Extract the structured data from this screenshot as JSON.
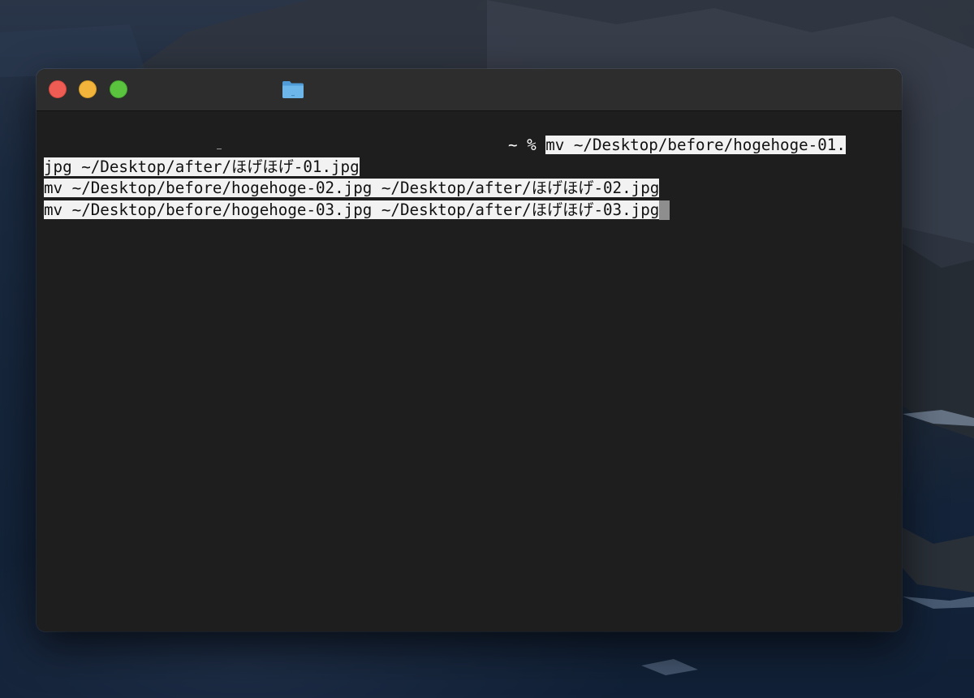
{
  "window": {
    "title_icon": "folder-icon",
    "title_icon_color": "#5aa6e0",
    "traffic_lights": {
      "close_color": "#ee5c54",
      "minimize_color": "#f2b43a",
      "zoom_color": "#5bc43f"
    }
  },
  "terminal": {
    "background": "#1e1e1e",
    "selection_color": "#f2f2f2",
    "prompt": "~ % ",
    "lines": [
      "mv ~/Desktop/before/hogehoge-01.",
      "jpg ~/Desktop/after/ほげほげ-01.jpg",
      "mv ~/Desktop/before/hogehoge-02.jpg ~/Desktop/after/ほげほげ-02.jpg",
      "mv ~/Desktop/before/hogehoge-03.jpg ~/Desktop/after/ほげほげ-03.jpg"
    ]
  }
}
